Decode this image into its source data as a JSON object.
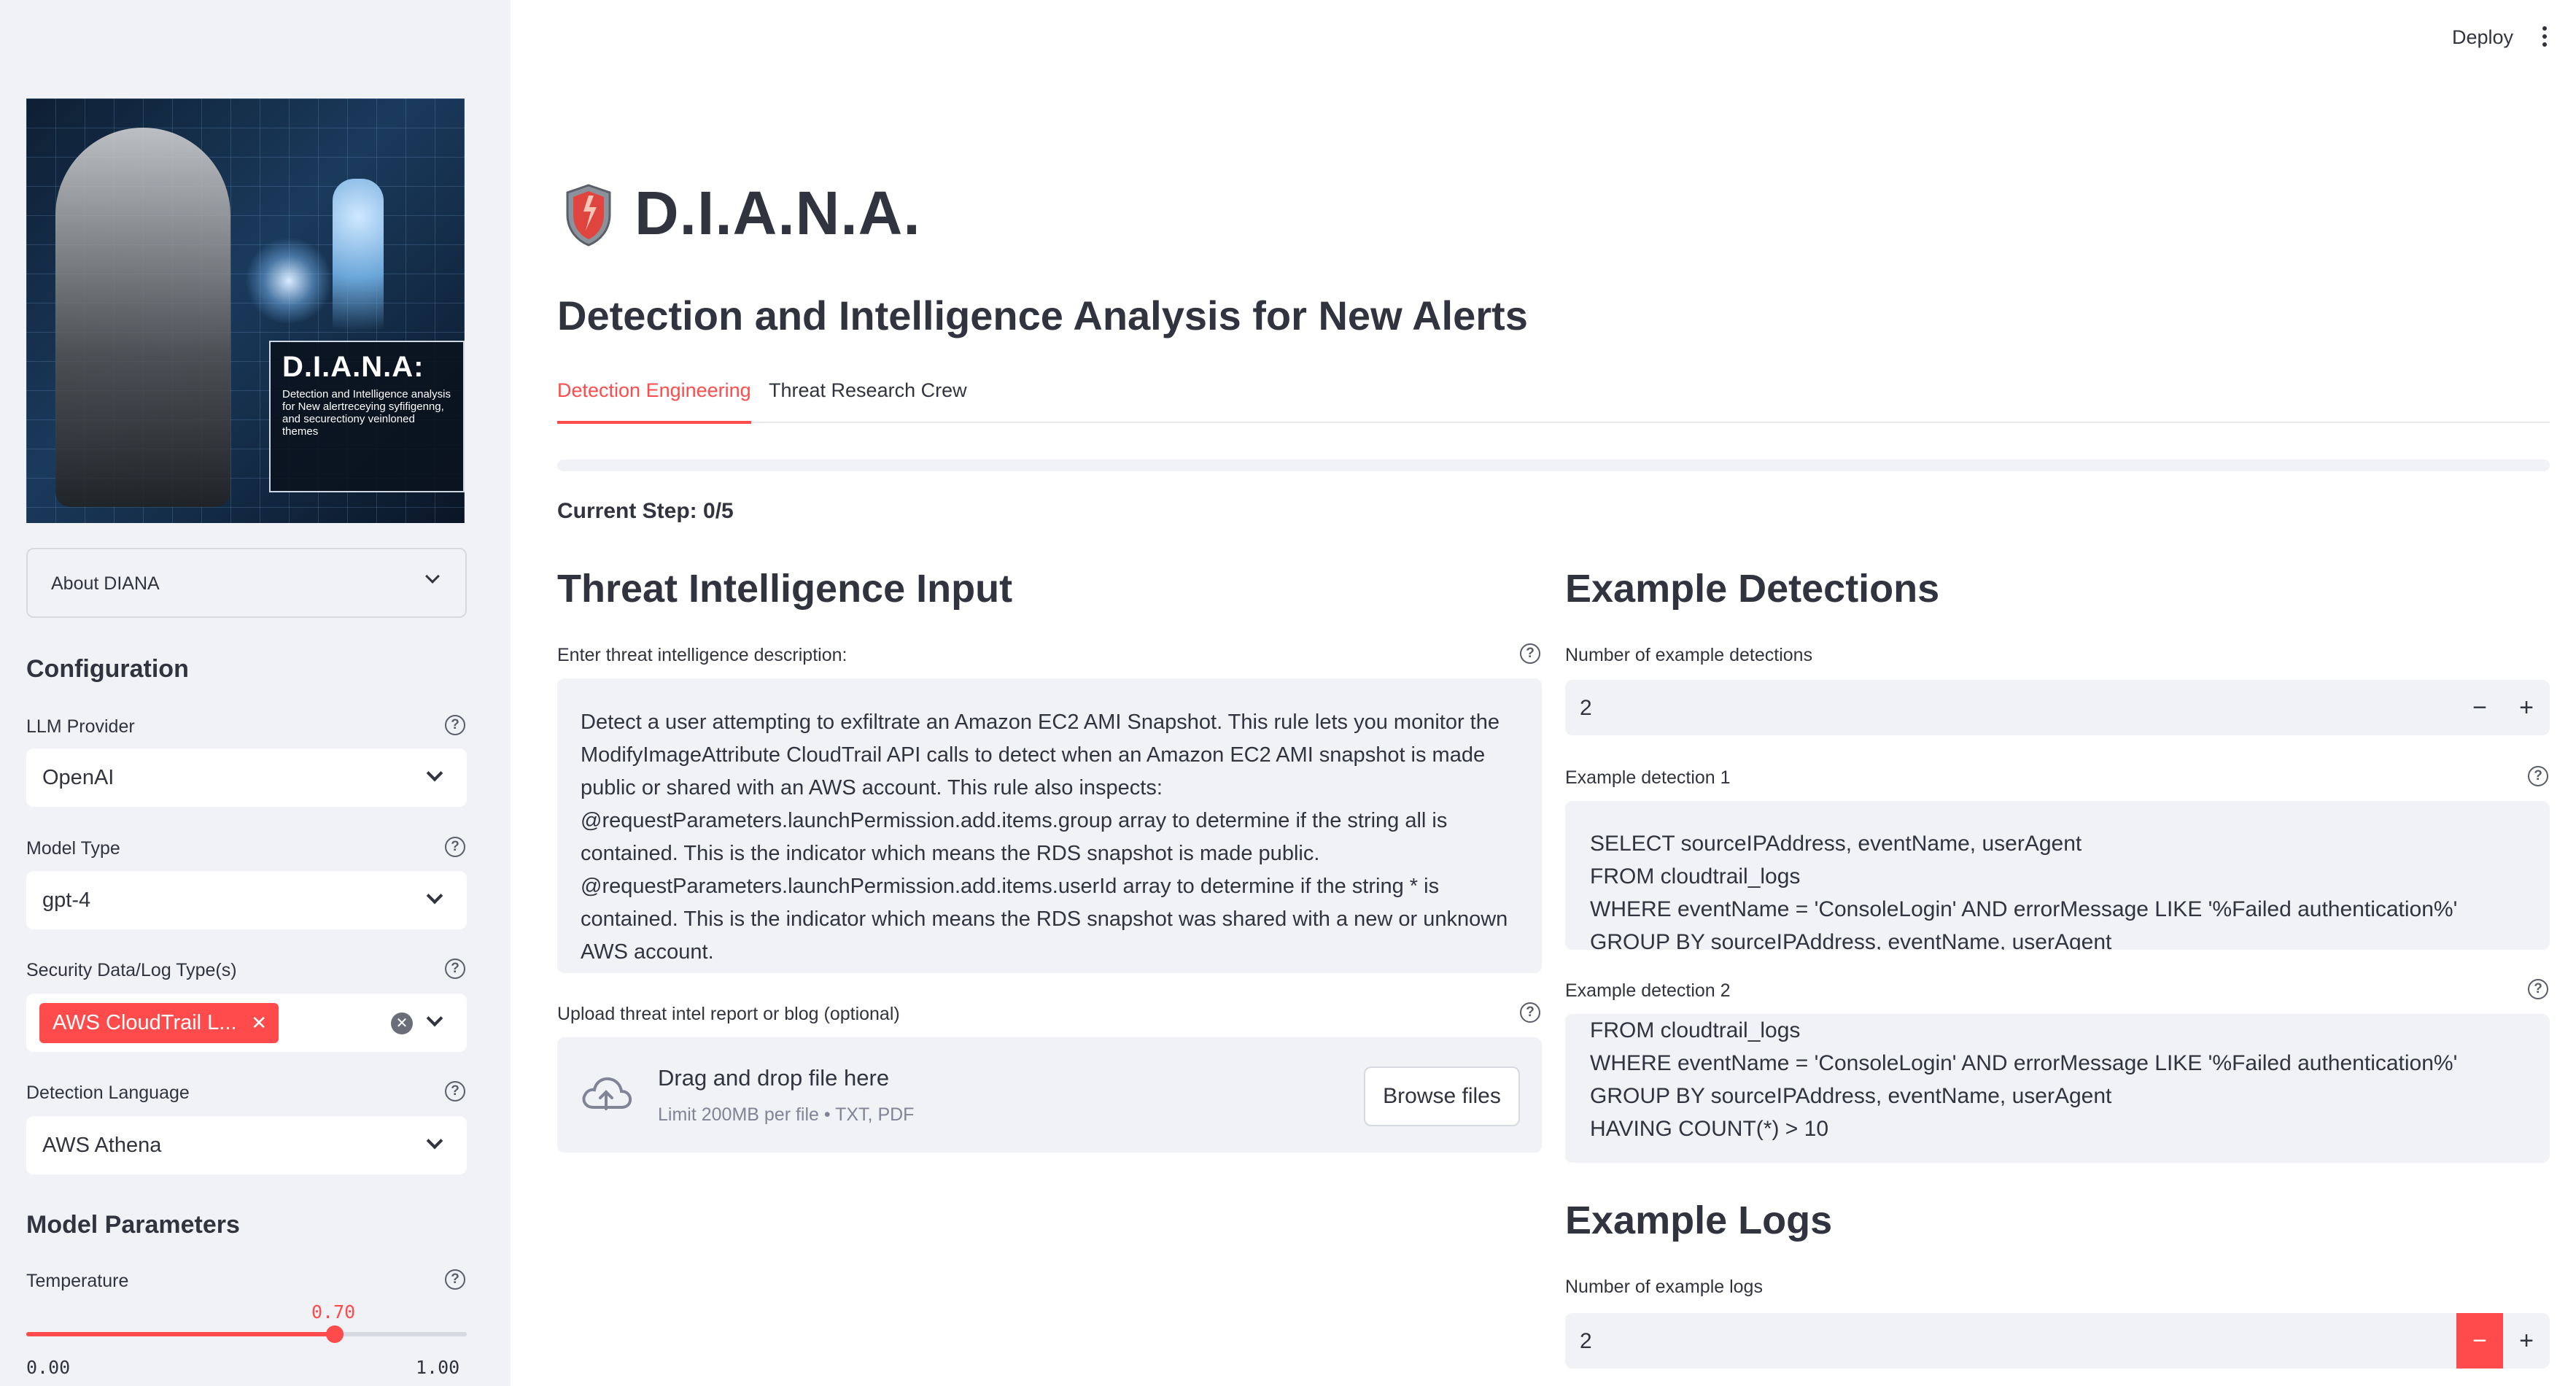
{
  "app": {
    "deploy_label": "Deploy",
    "title": "D.I.A.N.A.",
    "subtitle": "Detection and Intelligence Analysis for New Alerts",
    "brand_color": "#ff4b4b"
  },
  "sidebar": {
    "hero": {
      "badge_title": "D.I.A.N.A:",
      "badge_text": "Detection and Intelligence analysis for New alertreceying syfifigenng, and securectiony veinloned themes"
    },
    "about_label": "About DIANA",
    "configuration_heading": "Configuration",
    "llm_provider": {
      "label": "LLM Provider",
      "value": "OpenAI"
    },
    "model_type": {
      "label": "Model Type",
      "value": "gpt-4"
    },
    "log_types": {
      "label": "Security Data/Log Type(s)",
      "tags": [
        "AWS CloudTrail L..."
      ]
    },
    "detection_language": {
      "label": "Detection Language",
      "value": "AWS Athena"
    },
    "model_params_heading": "Model Parameters",
    "temperature": {
      "label": "Temperature",
      "value": 0.7,
      "value_text": "0.70",
      "min_text": "0.00",
      "max_text": "1.00"
    }
  },
  "tabs": [
    {
      "label": "Detection Engineering",
      "active": true
    },
    {
      "label": "Threat Research Crew",
      "active": false
    }
  ],
  "progress": {
    "value": 0
  },
  "current_step": "Current Step: 0/5",
  "threat_input": {
    "heading": "Threat Intelligence Input",
    "description_label": "Enter threat intelligence description:",
    "description_value": "Detect a user attempting to exfiltrate an Amazon EC2 AMI Snapshot. This rule lets you monitor the ModifyImageAttribute CloudTrail API calls to detect when an Amazon EC2 AMI snapshot is made public or shared with an AWS account. This rule also inspects: @requestParameters.launchPermission.add.items.group array to determine if the string all is contained. This is the indicator which means the RDS snapshot is made public. @requestParameters.launchPermission.add.items.userId array to determine if the string * is contained. This is the indicator which means the RDS snapshot was shared with a new or unknown AWS account.",
    "upload_label": "Upload threat intel report or blog (optional)",
    "upload_title": "Drag and drop file here",
    "upload_limit": "Limit 200MB per file • TXT, PDF",
    "browse_label": "Browse files"
  },
  "examples": {
    "heading": "Example Detections",
    "count_label": "Number of example detections",
    "count_value": "2",
    "detection1_label": "Example detection 1",
    "detection1_lines": [
      "SELECT sourceIPAddress, eventName, userAgent",
      "FROM cloudtrail_logs",
      "WHERE eventName = 'ConsoleLogin' AND errorMessage LIKE '%Failed authentication%'",
      "GROUP BY sourceIPAddress, eventName, userAgent"
    ],
    "detection2_label": "Example detection 2",
    "detection2_lines": [
      "FROM cloudtrail_logs",
      "WHERE eventName = 'ConsoleLogin' AND errorMessage LIKE '%Failed authentication%'",
      "GROUP BY sourceIPAddress, eventName, userAgent",
      "HAVING COUNT(*) > 10"
    ]
  },
  "logs": {
    "heading": "Example Logs",
    "count_label": "Number of example logs",
    "count_value": "2"
  },
  "stepper": {
    "minus": "−",
    "plus": "+"
  }
}
